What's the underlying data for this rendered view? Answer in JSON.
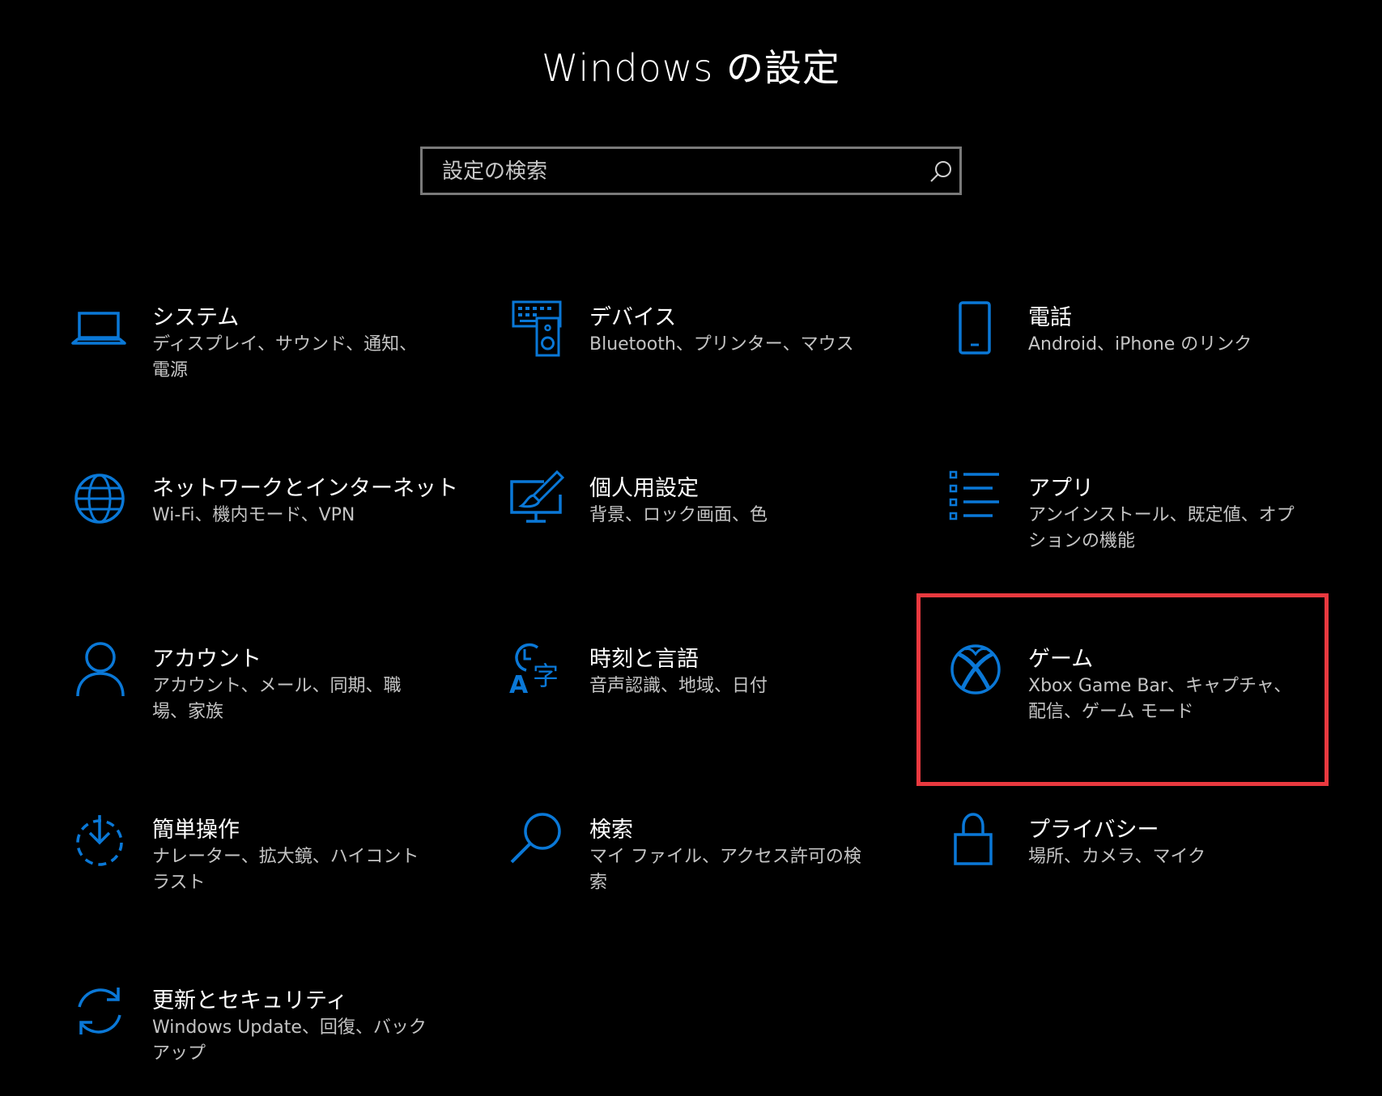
{
  "page": {
    "title": "Windows の設定"
  },
  "search": {
    "placeholder": "設定の検索"
  },
  "colors": {
    "background": "#000000",
    "accent": "#0a78d7",
    "highlight": "#e9393f",
    "secondary_text": "#c4c4c4"
  },
  "tiles": [
    {
      "id": "system",
      "icon": "laptop-icon",
      "title": "システム",
      "description": "ディスプレイ、サウンド、通知、電源"
    },
    {
      "id": "devices",
      "icon": "keyboard-speaker-icon",
      "title": "デバイス",
      "description": "Bluetooth、プリンター、マウス"
    },
    {
      "id": "phone",
      "icon": "phone-icon",
      "title": "電話",
      "description": "Android、iPhone のリンク"
    },
    {
      "id": "network",
      "icon": "globe-icon",
      "title": "ネットワークとインターネット",
      "description": "Wi-Fi、機内モード、VPN"
    },
    {
      "id": "personalization",
      "icon": "paintbrush-monitor-icon",
      "title": "個人用設定",
      "description": "背景、ロック画面、色"
    },
    {
      "id": "apps",
      "icon": "list-icon",
      "title": "アプリ",
      "description": "アンインストール、既定値、オプションの機能"
    },
    {
      "id": "accounts",
      "icon": "person-icon",
      "title": "アカウント",
      "description": "アカウント、メール、同期、職場、家族"
    },
    {
      "id": "time-language",
      "icon": "clock-language-icon",
      "title": "時刻と言語",
      "description": "音声認識、地域、日付"
    },
    {
      "id": "gaming",
      "icon": "xbox-icon",
      "title": "ゲーム",
      "description": "Xbox Game Bar、キャプチャ、配信、ゲーム モード"
    },
    {
      "id": "ease-of-access",
      "icon": "ease-of-access-icon",
      "title": "簡単操作",
      "description": "ナレーター、拡大鏡、ハイコントラスト"
    },
    {
      "id": "search",
      "icon": "magnifier-icon",
      "title": "検索",
      "description": "マイ ファイル、アクセス許可の検索"
    },
    {
      "id": "privacy",
      "icon": "lock-icon",
      "title": "プライバシー",
      "description": "場所、カメラ、マイク"
    },
    {
      "id": "update-security",
      "icon": "sync-icon",
      "title": "更新とセキュリティ",
      "description": "Windows Update、回復、バックアップ"
    }
  ]
}
